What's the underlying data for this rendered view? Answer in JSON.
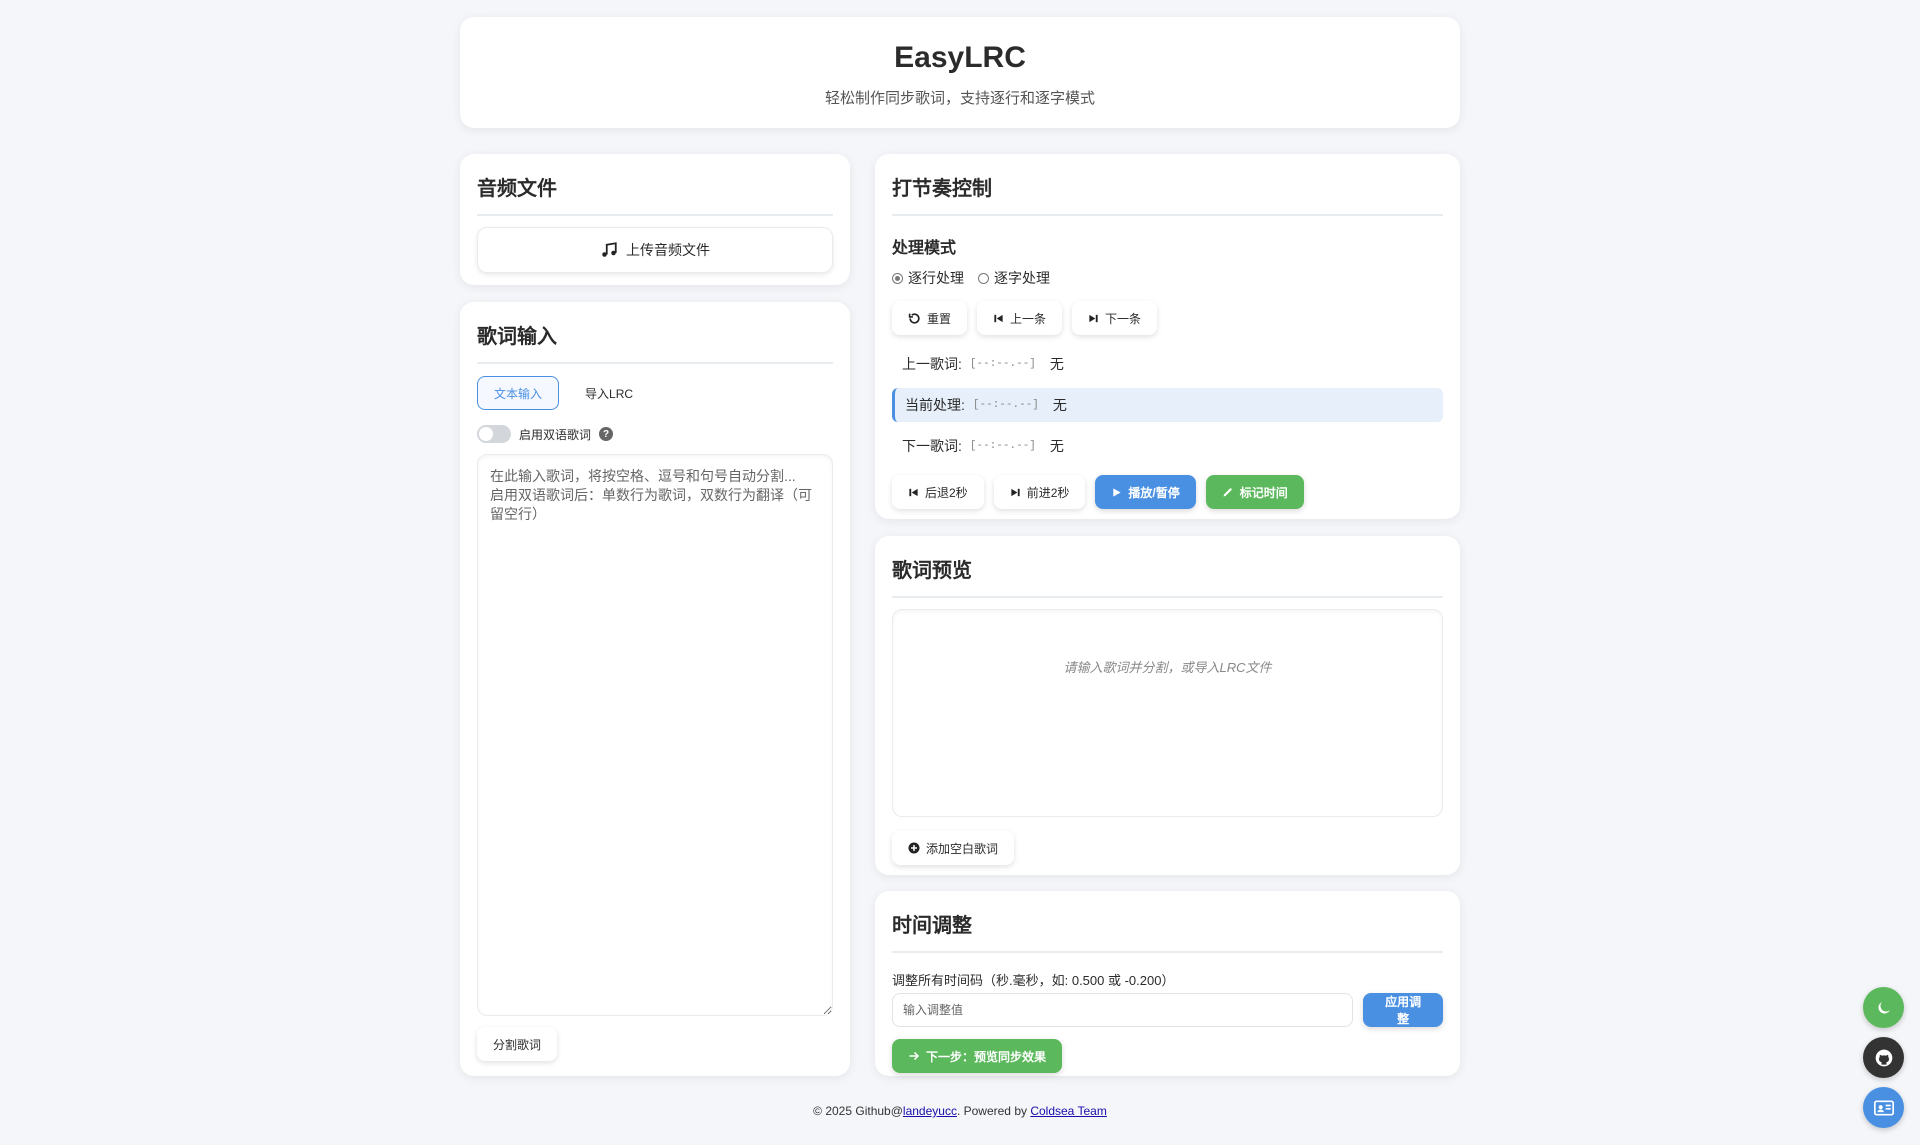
{
  "header": {
    "title": "EasyLRC",
    "subtitle": "轻松制作同步歌词，支持逐行和逐字模式"
  },
  "audio": {
    "title": "音频文件",
    "upload_label": "上传音频文件"
  },
  "lyrics_input": {
    "title": "歌词输入",
    "tabs": [
      {
        "label": "文本输入",
        "active": true
      },
      {
        "label": "导入LRC",
        "active": false
      }
    ],
    "bilingual_label": "启用双语歌词",
    "bilingual_enabled": false,
    "textarea_placeholder": "在此输入歌词，将按空格、逗号和句号自动分割...\n启用双语歌词后：单数行为歌词，双数行为翻译（可留空行）",
    "split_label": "分割歌词"
  },
  "tap_control": {
    "title": "打节奏控制",
    "mode_label": "处理模式",
    "modes": [
      {
        "label": "逐行处理",
        "checked": true
      },
      {
        "label": "逐字处理",
        "checked": false
      }
    ],
    "buttons": {
      "reset": "重置",
      "prev": "上一条",
      "next": "下一条",
      "back2": "后退2秒",
      "forward2": "前进2秒",
      "play_pause": "播放/暂停",
      "mark_time": "标记时间"
    },
    "lines": [
      {
        "label": "上一歌词:",
        "time": "[--:--.--]",
        "text": "无"
      },
      {
        "label": "当前处理:",
        "time": "[--:--.--]",
        "text": "无"
      },
      {
        "label": "下一歌词:",
        "time": "[--:--.--]",
        "text": "无"
      }
    ]
  },
  "preview": {
    "title": "歌词预览",
    "empty_text": "请输入歌词并分割，或导入LRC文件",
    "add_blank_label": "添加空白歌词"
  },
  "time_adjust": {
    "title": "时间调整",
    "label": "调整所有时间码（秒.毫秒，如: 0.500 或 -0.200）",
    "input_placeholder": "输入调整值",
    "apply_label": "应用调整",
    "next_step_label": "下一步：预览同步效果"
  },
  "footer": {
    "prefix": "© 2025 Github@",
    "author": "landeyucc",
    "middle": ". Powered by ",
    "team": "Coldsea Team"
  },
  "colors": {
    "primary_blue": "#4a90e2",
    "green": "#5cb85c",
    "dark": "#333333"
  },
  "icons": [
    "music-icon",
    "reset-icon",
    "skip-back-icon",
    "skip-forward-icon",
    "play-icon",
    "pen-icon",
    "plus-circle-icon",
    "arrow-right-icon",
    "moon-icon",
    "github-icon",
    "id-card-icon",
    "help-icon"
  ]
}
